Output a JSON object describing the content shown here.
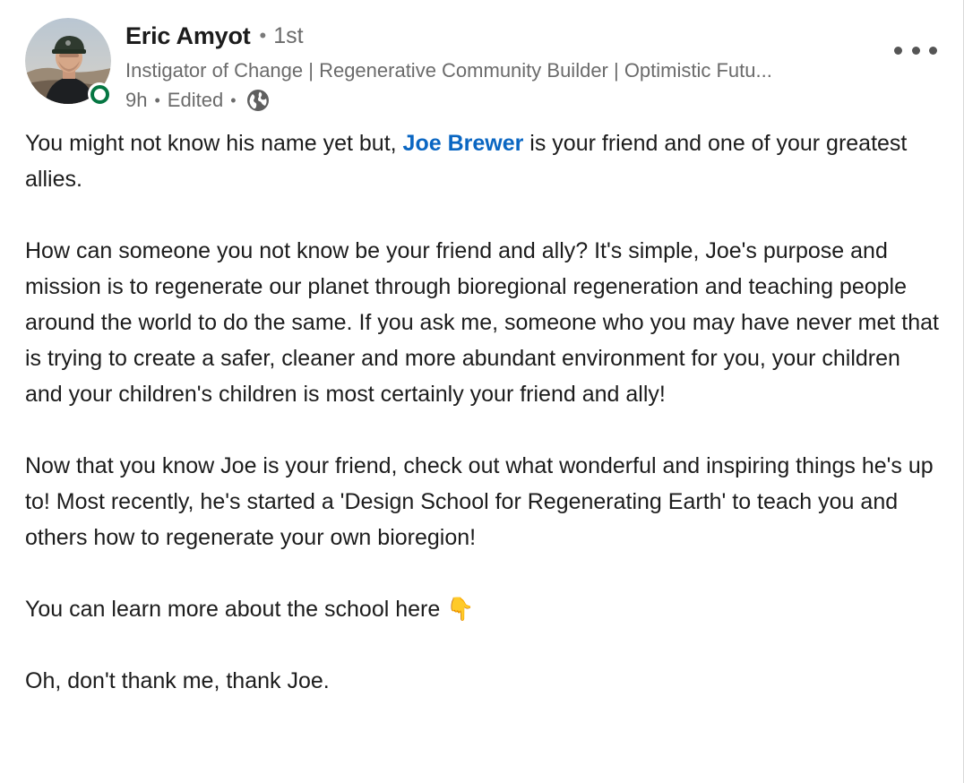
{
  "author": {
    "name": "Eric Amyot",
    "degree": "1st",
    "headline": "Instigator of Change | Regenerative Community Builder | Optimistic Futu...",
    "time": "9h",
    "edited": "Edited",
    "visibility_icon": "globe-icon",
    "online": true
  },
  "menu": {
    "icon": "more-horizontal-icon"
  },
  "post": {
    "p1_before": "You might not know his name yet but, ",
    "p1_mention": "Joe Brewer",
    "p1_after": " is your friend and one of your greatest allies.",
    "p2": "How can someone you not know be your friend and ally? It's simple, Joe's purpose and mission is to regenerate our planet through bioregional regeneration and teaching people around the world to do the same. If you ask me, someone who you may have never met that is trying to create a safer, cleaner and more abundant environment for you, your children and your children's children is most certainly your friend and ally!",
    "p3": "Now that you know Joe is your friend, check out what wonderful and inspiring things he's up to! Most recently, he's started a 'Design School for Regenerating Earth' to teach you and others how to regenerate your own bioregion!",
    "p4": "You can learn more about the school here 👇",
    "p5": "Oh, don't thank me, thank Joe."
  },
  "colors": {
    "mention": "#0a66c2",
    "online_ring": "#057642",
    "text": "#1c1c1c",
    "muted": "#6b6b6b"
  }
}
